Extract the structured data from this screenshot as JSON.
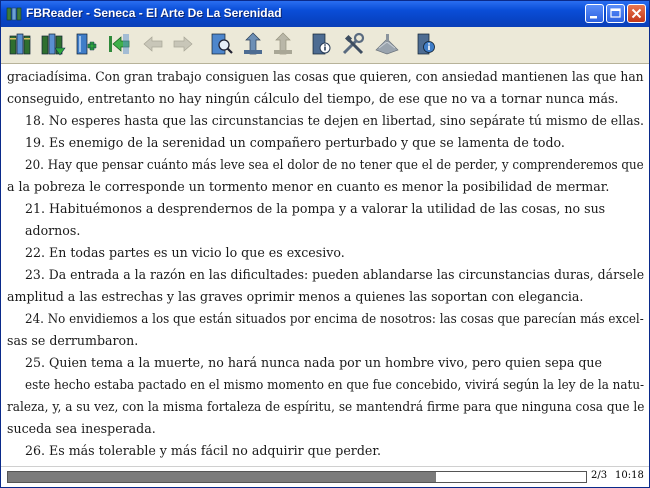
{
  "window": {
    "title": "FBReader - Seneca - El Arte De La Serenidad"
  },
  "toolbar": {
    "buttons": [
      {
        "name": "library-icon",
        "enabled": true
      },
      {
        "name": "recent-books-icon",
        "enabled": true
      },
      {
        "name": "add-book-icon",
        "enabled": true
      },
      {
        "name": "go-to-start-icon",
        "enabled": true
      },
      {
        "name": "back-arrow-icon",
        "enabled": false
      },
      {
        "name": "forward-arrow-icon",
        "enabled": false
      },
      {
        "name": "toc-icon",
        "enabled": true
      },
      {
        "name": "find-icon",
        "enabled": true
      },
      {
        "name": "find-next-icon",
        "enabled": false
      },
      {
        "name": "book-info-icon",
        "enabled": true
      },
      {
        "name": "preferences-icon",
        "enabled": true
      },
      {
        "name": "rotate-screen-icon",
        "enabled": false
      },
      {
        "name": "about-icon",
        "enabled": true
      }
    ]
  },
  "book": {
    "lines": [
      "graciadísima. Con gran trabajo consiguen las cosas que quieren, con ansiedad mantienen las que han",
      "conseguido, entretanto no hay ningún cálculo del tiempo, de ese que no va a tornar nunca más.",
      "18. No esperes hasta que las circunstancias te dejen en libertad, sino sepárate tú mismo de ellas.",
      "19. Es enemigo de la serenidad un compañero perturbado y que se lamenta de todo.",
      "20. Hay que pensar cuánto más leve sea el dolor de no tener que el de perder, y comprenderemos que",
      "a la pobreza le corresponde un tormento menor en cuanto es menor la posibilidad de mermar.",
      "21. Habituémonos a desprendernos de la pompa y a valorar la utilidad de las cosas, no sus",
      "adornos.",
      "22. En todas partes es un vicio lo que es excesivo.",
      "23. Da entrada a la razón en las dificultades: pueden ablandarse las circunstancias duras, dársele",
      "amplitud a las estrechas y las graves oprimir menos a quienes las soportan con elegancia.",
      "24. No envidiemos a los que están situados por encima de nosotros: las cosas que parecían más excel-",
      "sas se derrumbaron.",
      "25. Quien tema a la muerte, no hará nunca nada por un hombre vivo, pero quien sepa que",
      "este hecho estaba pactado en el mismo momento en que fue concebido, vivirá según la ley de la natu-",
      "raleza, y, a su vez, con la misma fortaleza de espíritu, se mantendrá firme para que ninguna cosa que le",
      "suceda sea inesperada.",
      "26. Es más tolerable y más fácil no adquirir que perder."
    ]
  },
  "status": {
    "page": "2/3",
    "time": "10:18",
    "progress": 0.74
  },
  "colors": {
    "titlebar": "#0a4ed8",
    "progress_fill": "#7b7b7b"
  }
}
